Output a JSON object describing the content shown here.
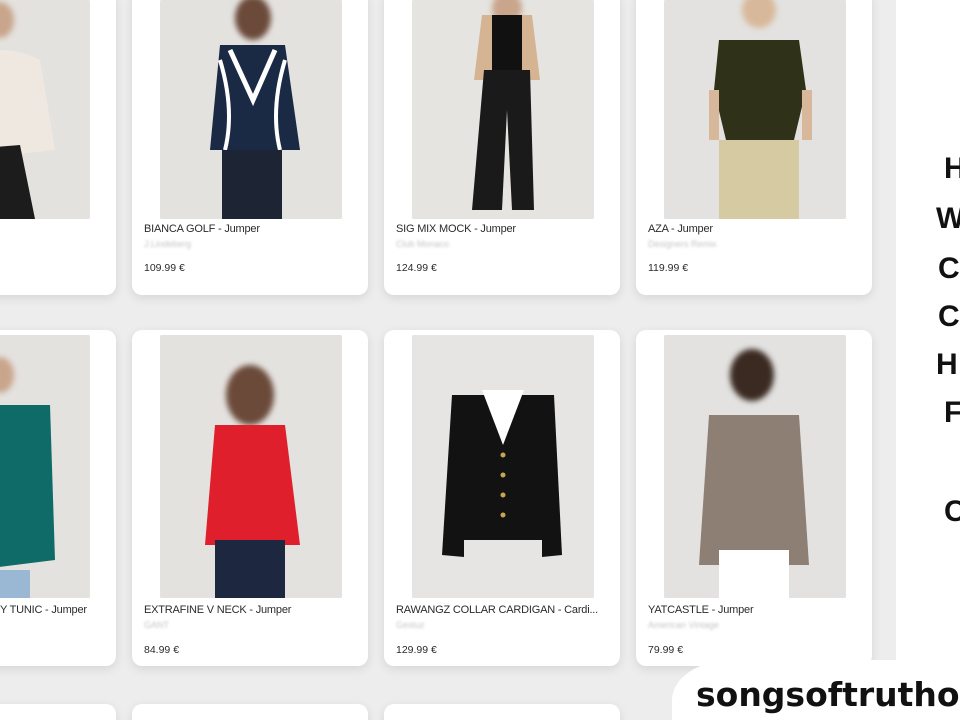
{
  "products": [
    {
      "name": "",
      "brand": "",
      "price": ""
    },
    {
      "name": "BIANCA GOLF - Jumper",
      "brand": "J.Lindeberg",
      "price": "109.99 €"
    },
    {
      "name": "SIG MIX MOCK - Jumper",
      "brand": "Club Monaco",
      "price": "124.99 €"
    },
    {
      "name": "AZA - Jumper",
      "brand": "Designers Remix",
      "price": "119.99 €"
    },
    {
      "name": "Y TUNIC - Jumper",
      "brand": "",
      "price": ""
    },
    {
      "name": "EXTRAFINE V NECK - Jumper",
      "brand": "GANT",
      "price": "84.99 €"
    },
    {
      "name": "RAWANGZ COLLAR CARDIGAN - Cardi...",
      "brand": "Gestuz",
      "price": "129.99 €"
    },
    {
      "name": "YATCASTLE - Jumper",
      "brand": "American Vintage",
      "price": "79.99 €"
    }
  ],
  "side_letters": [
    "H",
    "W",
    "C",
    "C",
    "H",
    "F",
    "C"
  ],
  "watermark": "songsoftrutho",
  "colors": {
    "background": "#ededed",
    "card": "#ffffff",
    "accent_text": "#2b2b2b"
  }
}
